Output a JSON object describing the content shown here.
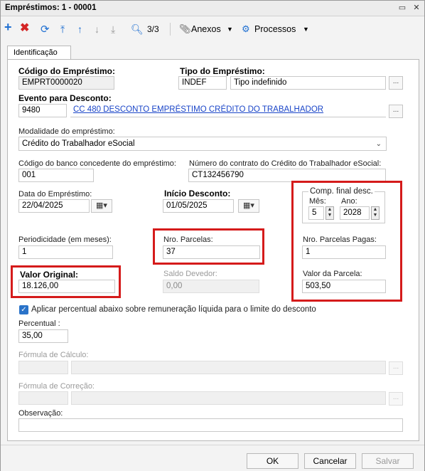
{
  "window": {
    "title": "Empréstimos: 1 - 00001",
    "minimize": "▭",
    "close": "✕"
  },
  "toolbar": {
    "record_counter": "3/3",
    "anexos_label": "Anexos",
    "processos_label": "Processos"
  },
  "tabs": [
    {
      "label": "Identificação"
    }
  ],
  "form": {
    "codigo_emprestimo": {
      "label": "Código do Empréstimo:",
      "value": "EMPRT0000020"
    },
    "tipo_emprestimo": {
      "label": "Tipo do Empréstimo:",
      "code": "INDEF",
      "description": "Tipo indefinido"
    },
    "evento_desconto": {
      "label": "Evento para Desconto:",
      "code": "9480",
      "description": "CC 480 DESCONTO EMPRÉSTIMO CRÉDITO DO TRABALHADOR"
    },
    "modalidade": {
      "label": "Modalidade do empréstimo:",
      "value": "Crédito do Trabalhador eSocial"
    },
    "codigo_banco": {
      "label": "Código do banco concedente do empréstimo:",
      "value": "001"
    },
    "numero_contrato": {
      "label": "Número do contrato do Crédito do Trabalhador eSocial:",
      "value": "CT132456790"
    },
    "data_emprestimo": {
      "label": "Data do Empréstimo:",
      "value": "22/04/2025"
    },
    "inicio_desconto": {
      "label": "Início Desconto:",
      "value": "01/05/2025"
    },
    "comp_final": {
      "label": "Comp. final desc.",
      "mes_label": "Mês:",
      "mes_value": "5",
      "ano_label": "Ano:",
      "ano_value": "2028"
    },
    "periodicidade": {
      "label": "Periodicidade (em meses):",
      "value": "1"
    },
    "nro_parcelas": {
      "label": "Nro. Parcelas:",
      "value": "37"
    },
    "nro_parcelas_pagas": {
      "label": "Nro. Parcelas Pagas:",
      "value": "1"
    },
    "valor_original": {
      "label": "Valor Original:",
      "value": "18.126,00"
    },
    "saldo_devedor": {
      "label": "Saldo Devedor:",
      "value": "0,00"
    },
    "valor_parcela": {
      "label": "Valor da Parcela:",
      "value": "503,50"
    },
    "aplicar_percentual": {
      "label": "Aplicar percentual abaixo sobre remuneração líquida para o limite do desconto",
      "checked": true
    },
    "percentual": {
      "label": "Percentual :",
      "value": "35,00"
    },
    "formula_calculo": {
      "label": "Fórmula de Cálculo:"
    },
    "formula_correcao": {
      "label": "Fórmula de Correção:"
    },
    "observacao": {
      "label": "Observação:",
      "value": ""
    }
  },
  "footer": {
    "ok_label": "OK",
    "cancel_label": "Cancelar",
    "save_label": "Salvar"
  },
  "colors": {
    "highlight_box": "#d51b1b",
    "link": "#1a45c8",
    "checkbox": "#2a73c9"
  }
}
